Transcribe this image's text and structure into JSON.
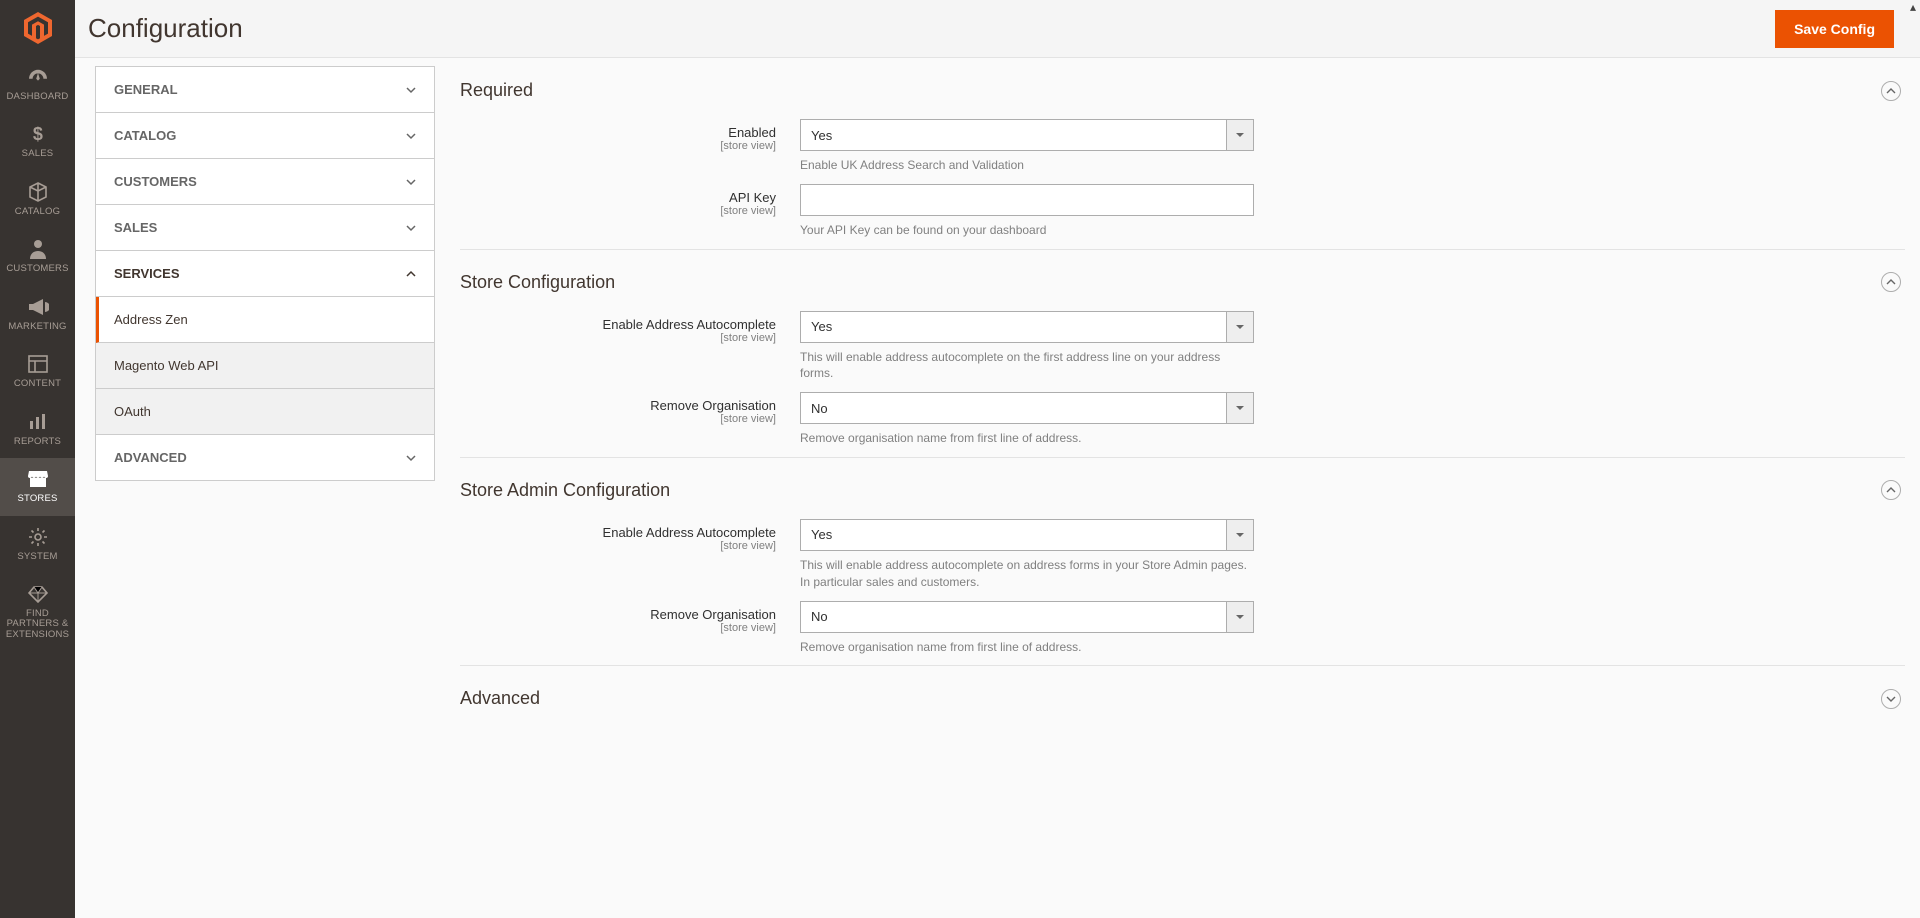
{
  "header": {
    "title": "Configuration",
    "save_label": "Save Config"
  },
  "nav": {
    "dashboard": "DASHBOARD",
    "sales": "SALES",
    "catalog": "CATALOG",
    "customers": "CUSTOMERS",
    "marketing": "MARKETING",
    "content": "CONTENT",
    "reports": "REPORTS",
    "stores": "STORES",
    "system": "SYSTEM",
    "partners": "FIND PARTNERS & EXTENSIONS"
  },
  "tabs": {
    "general": "GENERAL",
    "catalog": "CATALOG",
    "customers": "CUSTOMERS",
    "sales": "SALES",
    "services": "SERVICES",
    "advanced": "ADVANCED",
    "services_items": {
      "address_zen": "Address Zen",
      "magento_web_api": "Magento Web API",
      "oauth": "OAuth"
    }
  },
  "scope_label": "[store view]",
  "sections": {
    "required": {
      "title": "Required",
      "enabled": {
        "label": "Enabled",
        "value": "Yes",
        "note": "Enable UK Address Search and Validation"
      },
      "api_key": {
        "label": "API Key",
        "value": "",
        "note": "Your API Key can be found on your dashboard"
      }
    },
    "store_config": {
      "title": "Store Configuration",
      "autocomplete": {
        "label": "Enable Address Autocomplete",
        "value": "Yes",
        "note": "This will enable address autocomplete on the first address line on your address forms."
      },
      "remove_org": {
        "label": "Remove Organisation",
        "value": "No",
        "note": "Remove organisation name from first line of address."
      }
    },
    "admin_config": {
      "title": "Store Admin Configuration",
      "autocomplete": {
        "label": "Enable Address Autocomplete",
        "value": "Yes",
        "note": "This will enable address autocomplete on address forms in your Store Admin pages. In particular sales and customers."
      },
      "remove_org": {
        "label": "Remove Organisation",
        "value": "No",
        "note": "Remove organisation name from first line of address."
      }
    },
    "advanced": {
      "title": "Advanced"
    }
  }
}
